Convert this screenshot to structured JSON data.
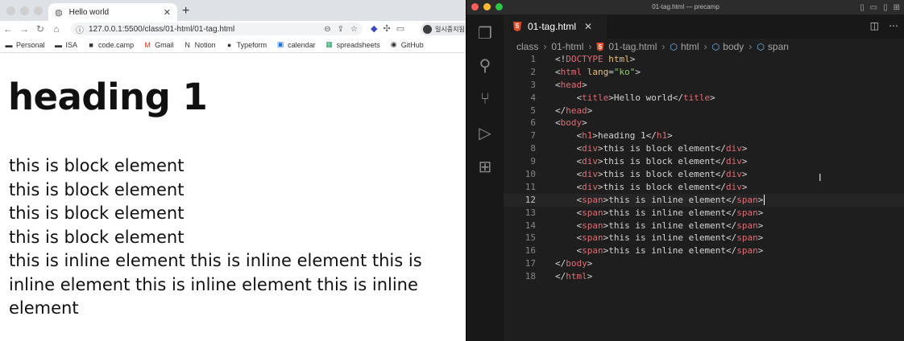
{
  "browser": {
    "tab_title": "Hello world",
    "url": "127.0.0.1:5500/class/01-html/01-tag.html",
    "profile_label": "일시중지됨",
    "bookmarks": [
      {
        "icon": "folder-icon",
        "label": "Personal"
      },
      {
        "icon": "folder-icon",
        "label": "ISA"
      },
      {
        "icon": "codecamp-icon",
        "label": "code.camp"
      },
      {
        "icon": "gmail-icon",
        "label": "Gmail"
      },
      {
        "icon": "notion-icon",
        "label": "Notion"
      },
      {
        "icon": "typeform-icon",
        "label": "Typeform"
      },
      {
        "icon": "calendar-icon",
        "label": "calendar"
      },
      {
        "icon": "spreadsheets-icon",
        "label": "spreadsheets"
      },
      {
        "icon": "github-icon",
        "label": "GitHub"
      }
    ],
    "page": {
      "heading": "heading 1",
      "blocks": [
        "this is block element",
        "this is block element",
        "this is block element",
        "this is block element"
      ],
      "inline_lines": [
        "this is inline element this is inline element this is",
        "inline element this is inline element this is inline",
        "element"
      ]
    }
  },
  "vscode": {
    "window_title": "01-tag.html — precamp",
    "tab_label": "01-tag.html",
    "breadcrumbs": [
      "class",
      "01-html",
      "01-tag.html",
      "html",
      "body",
      "span"
    ],
    "current_line": 12,
    "code_lines": [
      {
        "n": "1",
        "code": "<!DOCTYPE html>"
      },
      {
        "n": "2",
        "code": "<html lang=\"ko\">"
      },
      {
        "n": "3",
        "code": "<head>"
      },
      {
        "n": "4",
        "code": "    <title>Hello world</title>"
      },
      {
        "n": "5",
        "code": "</head>"
      },
      {
        "n": "6",
        "code": "<body>"
      },
      {
        "n": "7",
        "code": "    <h1>heading 1</h1>"
      },
      {
        "n": "8",
        "code": "    <div>this is block element</div>"
      },
      {
        "n": "9",
        "code": "    <div>this is block element</div>"
      },
      {
        "n": "10",
        "code": "    <div>this is block element</div>"
      },
      {
        "n": "11",
        "code": "    <div>this is block element</div>"
      },
      {
        "n": "12",
        "code": "    <span>this is inline element</span>"
      },
      {
        "n": "13",
        "code": "    <span>this is inline element</span>"
      },
      {
        "n": "14",
        "code": "    <span>this is inline element</span>"
      },
      {
        "n": "15",
        "code": "    <span>this is inline element</span>"
      },
      {
        "n": "16",
        "code": "    <span>this is inline element</span>"
      },
      {
        "n": "17",
        "code": "</body>"
      },
      {
        "n": "18",
        "code": "</html>"
      }
    ],
    "colors": {
      "tag": "#e06c75",
      "attr": "#e5c07b",
      "string": "#98c379",
      "text": "#d4d4d4"
    }
  }
}
